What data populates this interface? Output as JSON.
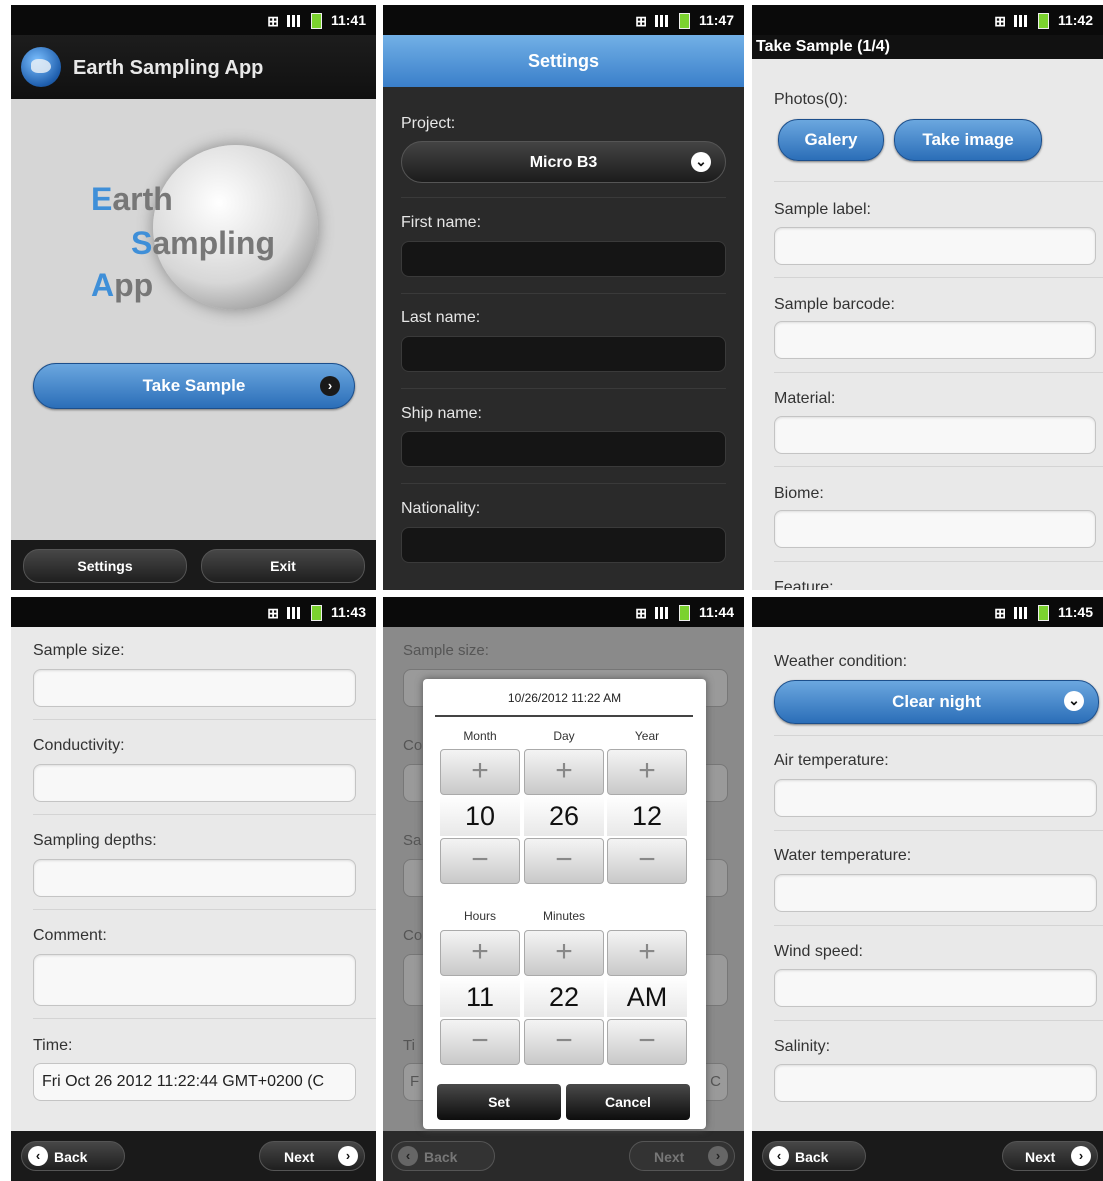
{
  "screens": {
    "home": {
      "time": "11:41",
      "app_title": "Earth Sampling App",
      "logo": [
        "Earth",
        "Sampling",
        "App"
      ],
      "take_sample": "Take Sample",
      "settings": "Settings",
      "exit": "Exit"
    },
    "settings": {
      "time": "11:47",
      "header": "Settings",
      "project_label": "Project:",
      "project_value": "Micro B3",
      "first_name": "First name:",
      "last_name": "Last name:",
      "ship_name": "Ship name:",
      "nationality": "Nationality:"
    },
    "take_sample": {
      "time": "11:42",
      "title": "Take Sample (1/4)",
      "photos": "Photos(0):",
      "gallery": "Galery",
      "take_image": "Take image",
      "sample_label": "Sample label:",
      "sample_barcode": "Sample barcode:",
      "material": "Material:",
      "biome": "Biome:",
      "feature": "Feature:"
    },
    "sample_details": {
      "time": "11:43",
      "sample_size": "Sample size:",
      "conductivity": "Conductivity:",
      "sampling_depths": "Sampling depths:",
      "comment": "Comment:",
      "time_label": "Time:",
      "time_value": "Fri Oct 26 2012 11:22:44 GMT+0200 (C",
      "back": "Back",
      "next": "Next"
    },
    "datetime_dialog": {
      "time": "11:44",
      "bg_sample_size": "Sample size:",
      "bg_co": "Co",
      "bg_sa": "Sa",
      "bg_co2": "Co",
      "bg_ti": "Ti",
      "bg_f": "F",
      "bg_c": "C",
      "dialog_title": "10/26/2012 11:22 AM",
      "month_head": "Month",
      "day_head": "Day",
      "year_head": "Year",
      "month": "10",
      "day": "26",
      "year": "12",
      "hours_head": "Hours",
      "minutes_head": "Minutes",
      "hours": "11",
      "minutes": "22",
      "ampm": "AM",
      "plus": "+",
      "minus": "−",
      "set": "Set",
      "cancel": "Cancel",
      "back": "Back",
      "next": "Next"
    },
    "weather": {
      "time": "11:45",
      "weather_label": "Weather condition:",
      "weather_value": "Clear night",
      "air_temp": "Air temperature:",
      "water_temp": "Water temperature:",
      "wind_speed": "Wind speed:",
      "salinity": "Salinity:",
      "back": "Back",
      "next": "Next"
    }
  },
  "icons": {
    "usb": "⊞",
    "chevron_right": "›",
    "chevron_left": "‹",
    "chevron_down": "⌄"
  },
  "colors": {
    "accent_blue": "#3a7fca",
    "battery_green": "#7bd22f"
  }
}
